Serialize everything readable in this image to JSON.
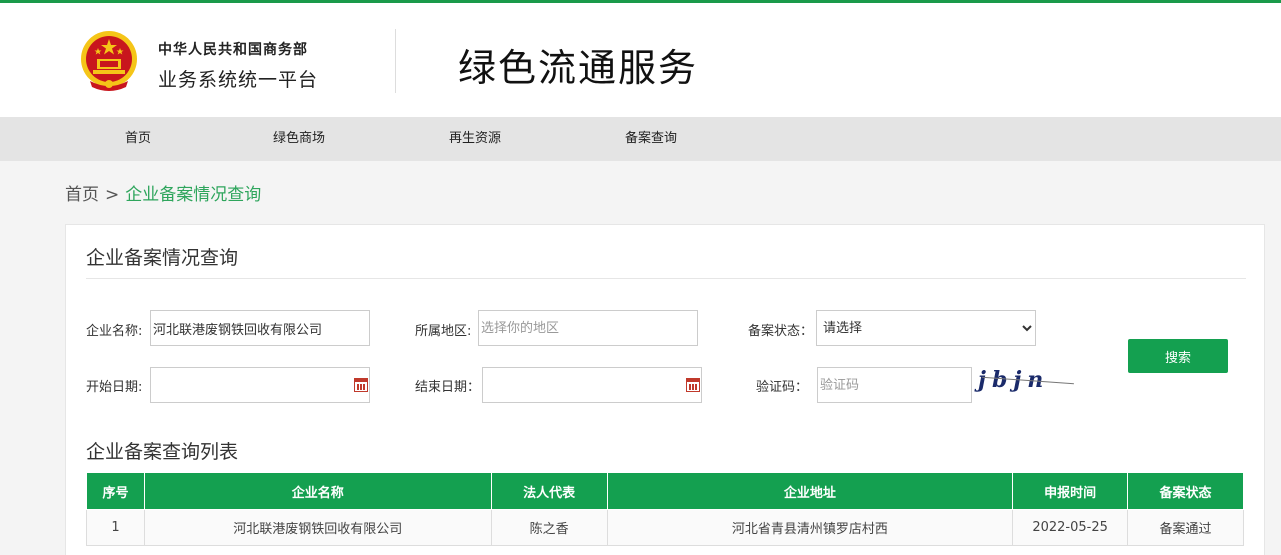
{
  "header": {
    "org_line1": "中华人民共和国商务部",
    "org_line2": "业务系统统一平台",
    "service_title": "绿色流通服务"
  },
  "nav": {
    "items": [
      {
        "label": "首页"
      },
      {
        "label": "绿色商场"
      },
      {
        "label": "再生资源"
      },
      {
        "label": "备案查询"
      }
    ]
  },
  "breadcrumb": {
    "home": "首页",
    "separator": ">",
    "current": "企业备案情况查询"
  },
  "search_panel": {
    "title": "企业备案情况查询",
    "company_name_label": "企业名称:",
    "company_name_value": "河北联港废钢铁回收有限公司",
    "region_label": "所属地区:",
    "region_placeholder": "选择你的地区",
    "status_label": "备案状态：",
    "status_selected": "请选择",
    "start_date_label": "开始日期:",
    "end_date_label": "结束日期：",
    "captcha_label": "验证码：",
    "captcha_placeholder": "验证码",
    "captcha_text": "jbjn",
    "search_button": "搜索"
  },
  "result_list": {
    "title": "企业备案查询列表",
    "columns": [
      "序号",
      "企业名称",
      "法人代表",
      "企业地址",
      "申报时间",
      "备案状态"
    ],
    "rows": [
      [
        "1",
        "河北联港废钢铁回收有限公司",
        "陈之香",
        "河北省青县清州镇罗店村西",
        "2022-05-25",
        "备案通过"
      ]
    ]
  },
  "colors": {
    "accent_green": "#14a050",
    "breadcrumb_green": "#2ea55c",
    "emblem_red": "#c8161d",
    "emblem_gold": "#f5c518"
  },
  "icons": [
    "national-emblem-icon",
    "calendar-icon",
    "chevron-down-icon"
  ]
}
